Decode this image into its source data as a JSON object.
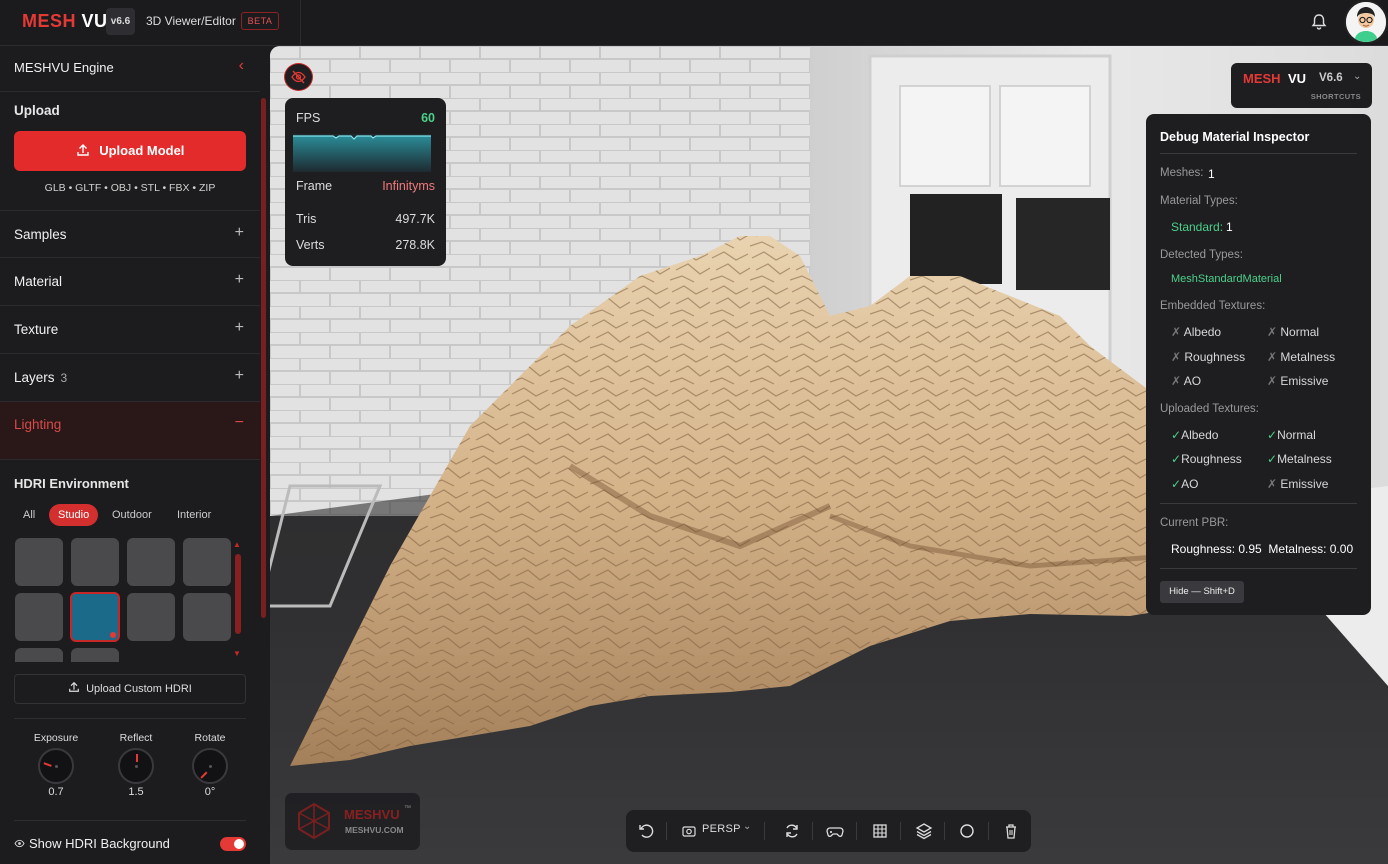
{
  "app": {
    "brand_left": "MESH",
    "brand_right": "VU",
    "version": "v6.6",
    "subtitle": "3D Viewer/Editor",
    "beta": "BETA"
  },
  "sidebar": {
    "engine_title": "MESHVU Engine",
    "upload_title": "Upload",
    "upload_button": "Upload Model",
    "formats": "GLB • GLTF • OBJ • STL • FBX • ZIP",
    "sections": [
      {
        "label": "Samples",
        "icon": "+"
      },
      {
        "label": "Material",
        "icon": "+"
      },
      {
        "label": "Texture",
        "icon": "+"
      },
      {
        "label": "Layers",
        "count": "3",
        "icon": "+"
      },
      {
        "label": "Lighting",
        "icon": "−"
      }
    ],
    "hdri": {
      "title": "HDRI Environment",
      "tabs": [
        "All",
        "Studio",
        "Outdoor",
        "Interior"
      ],
      "selected_tab": "Studio",
      "custom_button": "Upload Custom HDRI",
      "knobs": [
        {
          "label": "Exposure",
          "value": "0.7"
        },
        {
          "label": "Reflect",
          "value": "1.5"
        },
        {
          "label": "Rotate",
          "value": "0°"
        }
      ],
      "show_background_label": "Show HDRI Background",
      "show_background_on": true
    }
  },
  "stats": {
    "fps_label": "FPS",
    "fps_value": "60",
    "frame_label": "Frame",
    "frame_value": "Infinityms",
    "tris_label": "Tris",
    "tris_value": "497.7K",
    "verts_label": "Verts",
    "verts_value": "278.8K"
  },
  "logo_chip": {
    "mesh": "MESH",
    "vu": "VU",
    "version": "V6.6",
    "shortcuts": "SHORTCUTS"
  },
  "inspector": {
    "title": "Debug Material Inspector",
    "meshes_label": "Meshes:",
    "meshes_value": "1",
    "material_types_label": "Material Types:",
    "standard_label": "Standard:",
    "standard_value": "1",
    "detected_label": "Detected Types:",
    "detected_value": "MeshStandardMaterial",
    "embedded_label": "Embedded Textures:",
    "embedded": [
      "Albedo",
      "Normal",
      "Roughness",
      "Metalness",
      "AO",
      "Emissive"
    ],
    "uploaded_label": "Uploaded Textures:",
    "uploaded": [
      {
        "name": "Albedo",
        "ok": true
      },
      {
        "name": "Normal",
        "ok": true
      },
      {
        "name": "Roughness",
        "ok": true
      },
      {
        "name": "Metalness",
        "ok": true
      },
      {
        "name": "AO",
        "ok": true
      },
      {
        "name": "Emissive",
        "ok": false
      }
    ],
    "pbr_label": "Current PBR:",
    "pbr_value": "Roughness: 0.95  Metalness: 0.00",
    "hide_button": "Hide — Shift+D"
  },
  "watermark": {
    "name": "MESHVU",
    "tm": "™",
    "url": "MESHVU.COM"
  },
  "toolbar": {
    "camera_mode": "PERSP"
  },
  "colors": {
    "accent": "#e53935",
    "success": "#4cd08a"
  }
}
